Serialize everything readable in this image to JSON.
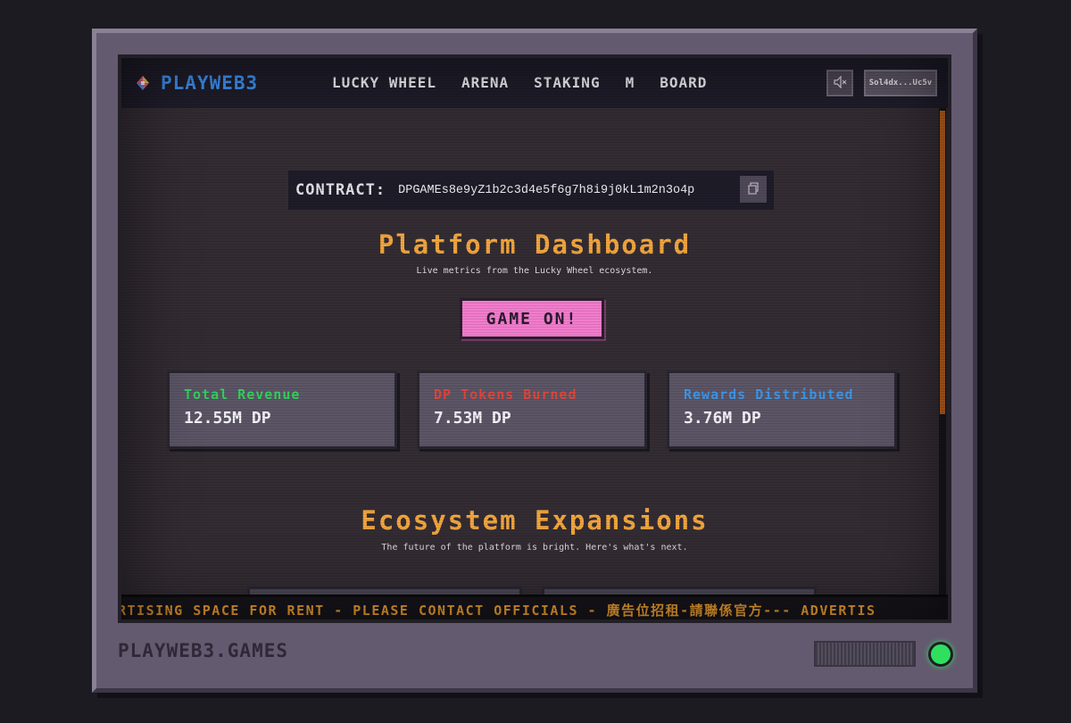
{
  "header": {
    "logo_text": "PLAYWEB3",
    "nav": [
      "LUCKY WHEEL",
      "ARENA",
      "STAKING",
      "M",
      "BOARD"
    ],
    "mute_icon": "speaker-muted-icon",
    "wallet": "Sol4dx...Uc5v"
  },
  "contract": {
    "label": "CONTRACT:",
    "address": "DPGAMEs8e9yZ1b2c3d4e5f6g7h8i9j0kL1m2n3o4p",
    "copy_icon": "copy-icon"
  },
  "dashboard": {
    "title": "Platform Dashboard",
    "subtitle": "Live metrics from the Lucky Wheel ecosystem.",
    "cta": "GAME ON!"
  },
  "stats": [
    {
      "label": "Total Revenue",
      "value": "12.55M DP",
      "color": "#33d15c"
    },
    {
      "label": "DP Tokens Burned",
      "value": "7.53M DP",
      "color": "#e0463a"
    },
    {
      "label": "Rewards Distributed",
      "value": "3.76M DP",
      "color": "#3d96e6"
    }
  ],
  "ecosystem": {
    "title": "Ecosystem Expansions",
    "subtitle": "The future of the platform is bright. Here's what's next."
  },
  "marquee": "RTISING SPACE FOR RENT - PLEASE CONTACT OFFICIALS - 廣告位招租-請聯係官方--- ADVERTIS",
  "footer": {
    "brand": "PLAYWEB3.GAMES",
    "power_color": "#2ee05e"
  }
}
